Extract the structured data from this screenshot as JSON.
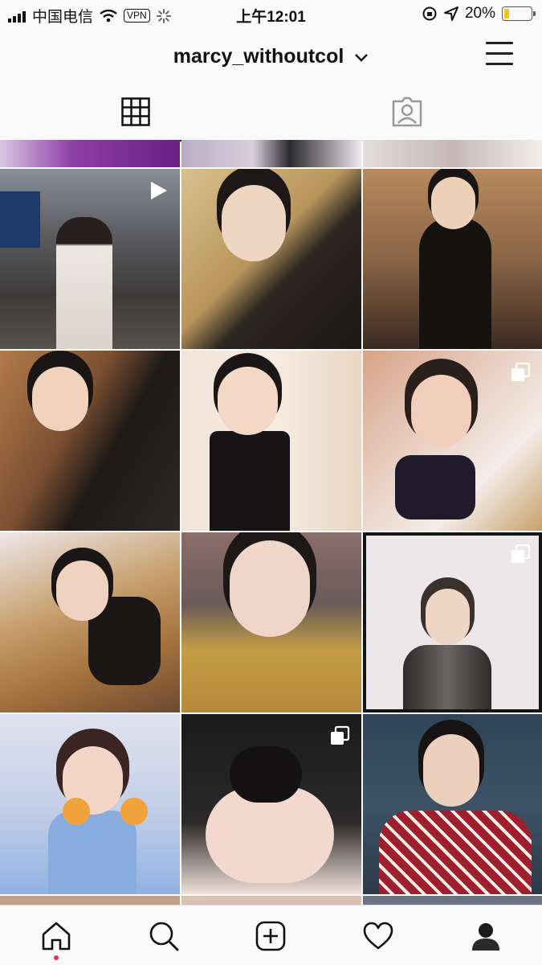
{
  "status_bar": {
    "carrier": "中国电信",
    "vpn": "VPN",
    "time": "上午12:01",
    "battery_percent": "20%",
    "battery_level": 0.2,
    "battery_color": "#f0c419"
  },
  "header": {
    "username": "marcy_withoutcol",
    "dropdown_icon": "chevron-down-icon",
    "menu_icon": "hamburger-icon"
  },
  "tabs": [
    {
      "name": "grid",
      "icon": "grid-icon",
      "active": true
    },
    {
      "name": "tagged",
      "icon": "tagged-icon",
      "active": false
    }
  ],
  "posts": [
    {
      "type": "video"
    },
    {
      "type": "photo"
    },
    {
      "type": "photo"
    },
    {
      "type": "photo"
    },
    {
      "type": "photo"
    },
    {
      "type": "multiple"
    },
    {
      "type": "photo"
    },
    {
      "type": "photo"
    },
    {
      "type": "multiple"
    },
    {
      "type": "photo"
    },
    {
      "type": "multiple"
    },
    {
      "type": "photo"
    }
  ],
  "bottom_nav": [
    {
      "name": "home",
      "icon": "home-icon",
      "active": true
    },
    {
      "name": "search",
      "icon": "search-icon"
    },
    {
      "name": "new-post",
      "icon": "add-post-icon"
    },
    {
      "name": "activity",
      "icon": "heart-icon"
    },
    {
      "name": "profile",
      "icon": "profile-icon"
    }
  ]
}
